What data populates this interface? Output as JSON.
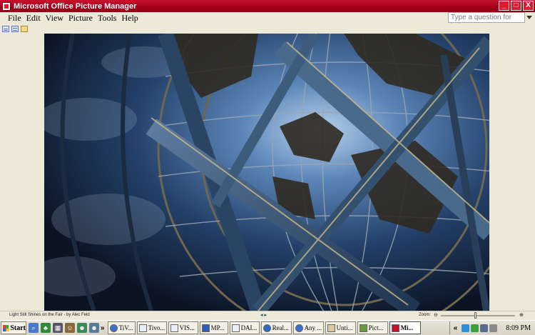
{
  "window": {
    "title": "Microsoft Office Picture Manager",
    "buttons": {
      "minimize": "_",
      "maximize": "□",
      "close": "X"
    }
  },
  "menu": {
    "items": [
      "File",
      "Edit",
      "View",
      "Picture",
      "Tools",
      "Help"
    ],
    "help_placeholder": "Type a question for help"
  },
  "toolbar": {
    "views": [
      {
        "icon": "thumbnail-view-icon",
        "active": false
      },
      {
        "icon": "filmstrip-view-icon",
        "active": false
      },
      {
        "icon": "single-picture-view-icon",
        "active": true
      }
    ]
  },
  "picture": {
    "icon": "unisphere-photo",
    "colors": {
      "sky_dark": "#0f1a2c",
      "sky_mid": "#2e4f7a",
      "sky_light": "#8fb3d6",
      "steel": "#3d5c7c",
      "land": "#3a3226"
    }
  },
  "status": {
    "caption": "Light Still Shines on the Fair - by Alec Feld",
    "nav": "◂  ▸",
    "zoom_label": "Zoom:",
    "zoom_minus": "⊖",
    "zoom_plus": "⊕"
  },
  "taskbar": {
    "start_label": "Start",
    "overflow": "»",
    "tray_overflow": "«",
    "clock": "8:09 PM",
    "quick_launch": [
      "search-icon",
      "tree-icon",
      "grid-icon",
      "user-icon",
      "people-icon",
      "people-icon"
    ],
    "tasks": [
      {
        "label": "TiV...",
        "icon": "ie-icon",
        "active": false
      },
      {
        "label": "Tivo...",
        "icon": "window-icon",
        "active": false
      },
      {
        "label": "VIS...",
        "icon": "window-icon",
        "active": false
      },
      {
        "label": "MP...",
        "icon": "pen-icon",
        "active": false
      },
      {
        "label": "DAI...",
        "icon": "window-icon",
        "active": false
      },
      {
        "label": "Real...",
        "icon": "globe-icon",
        "active": false
      },
      {
        "label": "Any ...",
        "icon": "ie-icon",
        "active": false
      },
      {
        "label": "Unti...",
        "icon": "paint-icon",
        "active": false
      },
      {
        "label": "Pict...",
        "icon": "pen-icon",
        "active": false
      },
      {
        "label": "Mi...",
        "icon": "picture-manager-icon",
        "active": true
      }
    ],
    "tray_icons": [
      "network-icon",
      "shield-icon",
      "monitor-icon",
      "speaker-icon"
    ]
  }
}
